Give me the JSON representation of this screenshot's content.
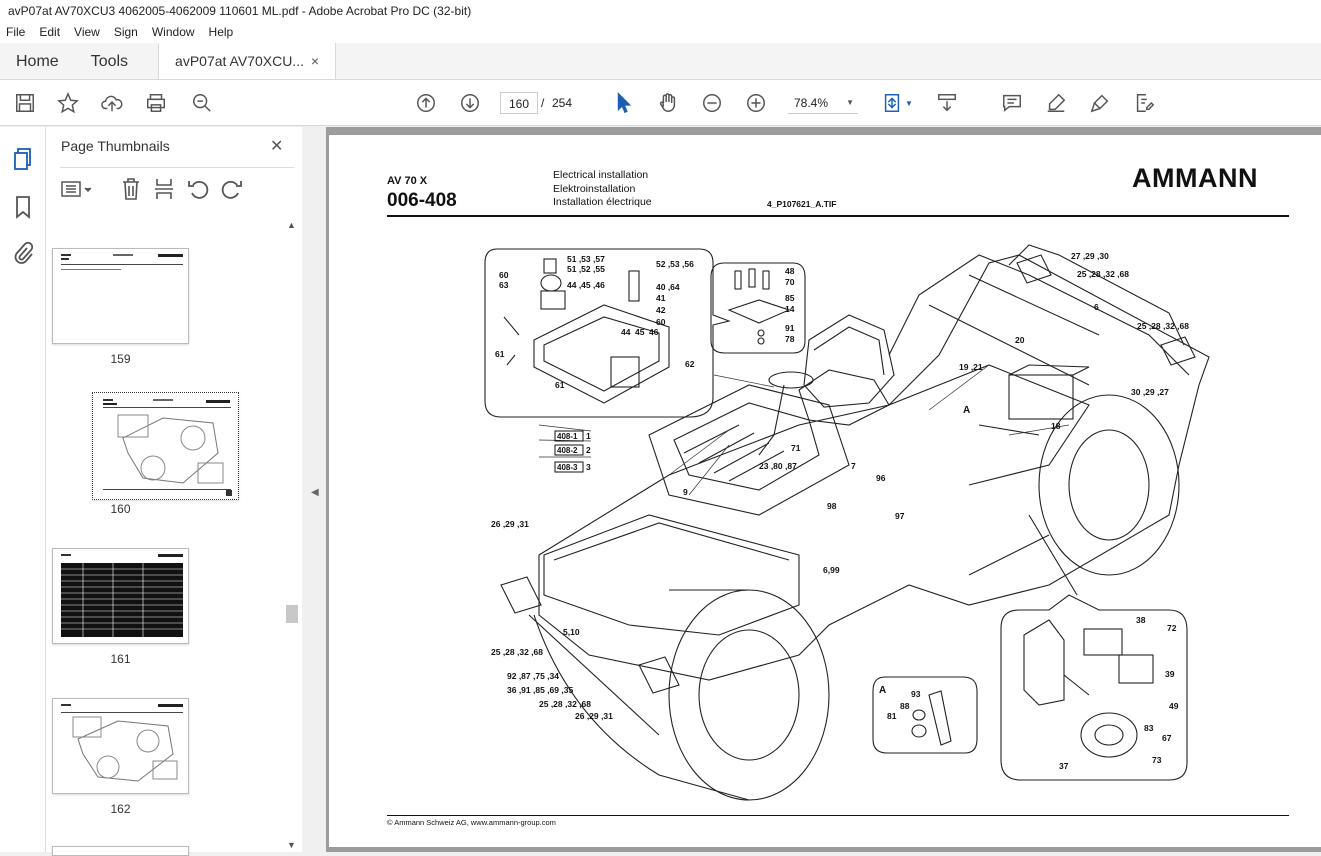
{
  "window": {
    "title": "avP07at AV70XCU3 4062005-4062009 110601 ML.pdf - Adobe Acrobat Pro DC (32-bit)"
  },
  "menu": [
    "File",
    "Edit",
    "View",
    "Sign",
    "Window",
    "Help"
  ],
  "tabs": {
    "home": "Home",
    "tools": "Tools",
    "doc": "avP07at AV70XCU...",
    "close": "×"
  },
  "toolbar": {
    "page_current": "160",
    "page_sep": "/",
    "page_total": "254",
    "zoom": "78.4%"
  },
  "panel": {
    "title": "Page Thumbnails",
    "close": "✕"
  },
  "thumbnails": [
    "159",
    "160",
    "161",
    "162"
  ],
  "doc": {
    "model": "AV 70 X",
    "code": "006-408",
    "desc_en": "Electrical installation",
    "desc_de": "Elektroinstallation",
    "desc_fr": "Installation électrique",
    "file": "4_P107621_A.TIF",
    "brand": "AMMANN",
    "footer": "© Ammann Schweiz AG, www.ammann-group.com"
  },
  "callouts": [
    {
      "t": "51 ,53 ,57"
    },
    {
      "t": "51 ,52 ,55"
    },
    {
      "t": "44 ,45 ,46"
    },
    {
      "t": "60"
    },
    {
      "t": "63"
    },
    {
      "t": "52 ,53 ,56"
    },
    {
      "t": "40 ,64"
    },
    {
      "t": "41"
    },
    {
      "t": "42"
    },
    {
      "t": "60"
    },
    {
      "t": "44"
    },
    {
      "t": "45"
    },
    {
      "t": "46"
    },
    {
      "t": "61"
    },
    {
      "t": "61"
    },
    {
      "t": "62"
    },
    {
      "t": "48"
    },
    {
      "t": "70"
    },
    {
      "t": "85"
    },
    {
      "t": "14"
    },
    {
      "t": "91"
    },
    {
      "t": "78"
    },
    {
      "t": "27 ,29 ,30"
    },
    {
      "t": "25 ,28 ,32 ,68"
    },
    {
      "t": "6"
    },
    {
      "t": "25 ,28 ,32 ,68"
    },
    {
      "t": "20"
    },
    {
      "t": "19 ,21"
    },
    {
      "t": "30 ,29 ,27"
    },
    {
      "t": "18"
    },
    {
      "t": "A"
    },
    {
      "t": "1"
    },
    {
      "t": "2"
    },
    {
      "t": "3"
    },
    {
      "t": "71"
    },
    {
      "t": "23 ,80 ,87"
    },
    {
      "t": "7"
    },
    {
      "t": "96"
    },
    {
      "t": "9"
    },
    {
      "t": "98"
    },
    {
      "t": "97"
    },
    {
      "t": "26 ,29 ,31"
    },
    {
      "t": "6,99"
    },
    {
      "t": "5,10"
    },
    {
      "t": "25 ,28 ,32 ,68"
    },
    {
      "t": "92 ,87 ,75 ,34"
    },
    {
      "t": "36 ,91 ,85 ,69 ,35"
    },
    {
      "t": "25 ,28 ,32 ,68"
    },
    {
      "t": "26 ,29 ,31"
    },
    {
      "t": "A"
    },
    {
      "t": "93"
    },
    {
      "t": "88"
    },
    {
      "t": "81"
    },
    {
      "t": "38"
    },
    {
      "t": "72"
    },
    {
      "t": "39"
    },
    {
      "t": "49"
    },
    {
      "t": "83"
    },
    {
      "t": "67"
    },
    {
      "t": "37"
    },
    {
      "t": "73"
    }
  ],
  "refboxes": [
    "408-1",
    "408-2",
    "408-3"
  ]
}
